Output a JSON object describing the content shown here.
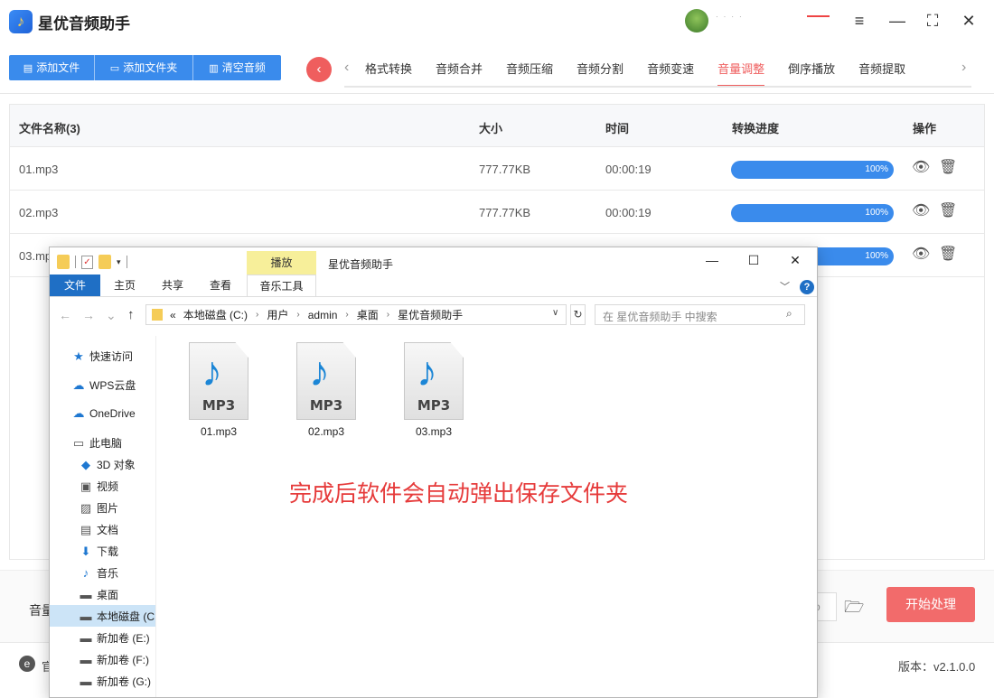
{
  "app": {
    "logo_glyph": "♪",
    "title": "星优音频助手",
    "user_name": "····",
    "win_controls": [
      "≡",
      "—",
      "⛶",
      "✕"
    ]
  },
  "toolbar": {
    "add_file": "添加文件",
    "add_folder": "添加文件夹",
    "clear": "清空音频",
    "back_icon": "‹",
    "prev_icon": "‹",
    "next_icon": "›"
  },
  "tabs": [
    "格式转换",
    "音频合并",
    "音频压缩",
    "音频分割",
    "音频变速",
    "音量调整",
    "倒序播放",
    "音频提取"
  ],
  "active_tab": "音量调整",
  "table": {
    "headers": {
      "name": "文件名称(3)",
      "size": "大小",
      "time": "时间",
      "progress": "转换进度",
      "actions": "操作"
    },
    "rows": [
      {
        "name": "01.mp3",
        "size": "777.77KB",
        "time": "00:00:19",
        "progress": "100%"
      },
      {
        "name": "02.mp3",
        "size": "777.77KB",
        "time": "00:00:19",
        "progress": "100%"
      },
      {
        "name": "03.mp3",
        "size": "",
        "time": "",
        "progress": "100%"
      }
    ]
  },
  "bottom": {
    "volume_label": "音量",
    "path_fragment": "o",
    "start_button": "开始处理",
    "web_text": "官",
    "version": "版本：v2.1.0.0"
  },
  "explorer": {
    "context_tab": "播放",
    "title": "星优音频助手",
    "ribbon_tabs": [
      "文件",
      "主页",
      "共享",
      "查看",
      "音乐工具"
    ],
    "address": [
      "本地磁盘 (C:)",
      "用户",
      "admin",
      "桌面",
      "星优音频助手"
    ],
    "address_prefix": "«",
    "search_placeholder": "在 星优音频助手 中搜索",
    "nav": [
      {
        "label": "快速访问",
        "icon": "star-icon"
      },
      {
        "label": "WPS云盘",
        "icon": "cloud-icon"
      },
      {
        "label": "OneDrive",
        "icon": "onedrive-icon"
      },
      {
        "label": "此电脑",
        "icon": "computer-icon"
      },
      {
        "label": "3D 对象",
        "icon": "cube-icon"
      },
      {
        "label": "视频",
        "icon": "video-icon"
      },
      {
        "label": "图片",
        "icon": "picture-icon"
      },
      {
        "label": "文档",
        "icon": "document-icon"
      },
      {
        "label": "下载",
        "icon": "download-icon"
      },
      {
        "label": "音乐",
        "icon": "music-icon"
      },
      {
        "label": "桌面",
        "icon": "desktop-icon"
      },
      {
        "label": "本地磁盘 (C",
        "icon": "drive-icon"
      },
      {
        "label": "新加卷 (E:)",
        "icon": "drive-icon"
      },
      {
        "label": "新加卷 (F:)",
        "icon": "drive-icon"
      },
      {
        "label": "新加卷 (G:)",
        "icon": "drive-icon"
      }
    ],
    "files": [
      {
        "name": "01.mp3",
        "badge": "MP3"
      },
      {
        "name": "02.mp3",
        "badge": "MP3"
      },
      {
        "name": "03.mp3",
        "badge": "MP3"
      }
    ],
    "annotation": "完成后软件会自动弹出保存文件夹"
  },
  "colors": {
    "accent": "#3a8bec",
    "active_tab": "#ef5e5e",
    "start": "#f26b6b",
    "annotation": "#e63b3b"
  }
}
